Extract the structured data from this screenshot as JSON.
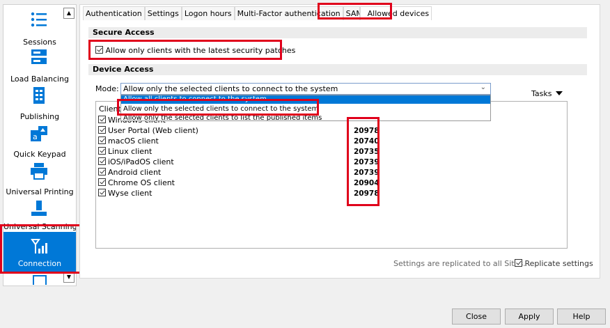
{
  "sidebar": {
    "items": [
      {
        "label": "Sessions",
        "icon": "list-icon"
      },
      {
        "label": "Load Balancing",
        "icon": "server-icon"
      },
      {
        "label": "Publishing",
        "icon": "document-icon"
      },
      {
        "label": "Quick Keypad",
        "icon": "keypad-icon"
      },
      {
        "label": "Universal Printing",
        "icon": "printer-icon"
      },
      {
        "label": "Universal Scanning",
        "icon": "scanner-icon"
      },
      {
        "label": "Connection",
        "icon": "signal-icon"
      }
    ],
    "scroll_up": "▲",
    "scroll_down": "▼"
  },
  "tabs": [
    "Authentication",
    "Settings",
    "Logon hours",
    "Multi-Factor authentication",
    "SAML",
    "Allowed devices"
  ],
  "secure_access": {
    "header": "Secure Access",
    "checkbox_label": "Allow only clients with the latest security patches"
  },
  "device_access": {
    "header": "Device Access",
    "mode_label": "Mode:",
    "mode_value": "Allow only the selected clients to connect to the system",
    "options": [
      "Allow all clients to connect to the system",
      "Allow only the selected clients to connect to the system",
      "Allow only the selected clients to list the published items"
    ],
    "tasks_label": "Tasks"
  },
  "clients": {
    "header": "Client",
    "rows": [
      {
        "name": "Windows client",
        "version": ""
      },
      {
        "name": "User Portal (Web client)",
        "version": "20978"
      },
      {
        "name": "macOS client",
        "version": "20740"
      },
      {
        "name": "Linux client",
        "version": "20735"
      },
      {
        "name": "iOS/iPadOS client",
        "version": "20739"
      },
      {
        "name": "Android client",
        "version": "20739"
      },
      {
        "name": "Chrome OS client",
        "version": "20904"
      },
      {
        "name": "Wyse client",
        "version": "20978"
      }
    ]
  },
  "footer": {
    "note": "Settings are replicated to all Sites.",
    "replicate_label": "Replicate settings"
  },
  "buttons": {
    "close": "Close",
    "apply": "Apply",
    "help": "Help"
  },
  "colors": {
    "accent": "#0078d7",
    "highlight_box": "#e0001b"
  }
}
